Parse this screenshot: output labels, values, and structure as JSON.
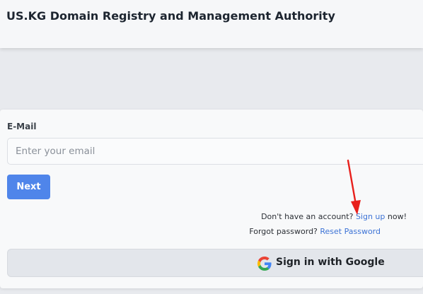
{
  "header": {
    "title": "US.KG Domain Registry and Management Authority"
  },
  "form": {
    "email_label": "E-Mail",
    "email_placeholder": "Enter your email",
    "email_value": "",
    "next_label": "Next"
  },
  "links": {
    "signup_prefix": "Don't have an account?",
    "signup_link": "Sign up",
    "signup_suffix": "now!",
    "forgot_prefix": "Forgot password?",
    "reset_link": "Reset Password"
  },
  "google": {
    "icon": "google-g-icon",
    "label": "Sign in with Google"
  },
  "annotation": {
    "icon": "red-arrow-icon",
    "color": "#e8201c"
  },
  "colors": {
    "accent": "#4f85ea",
    "link": "#3d73d6",
    "background": "#e8eaee"
  }
}
